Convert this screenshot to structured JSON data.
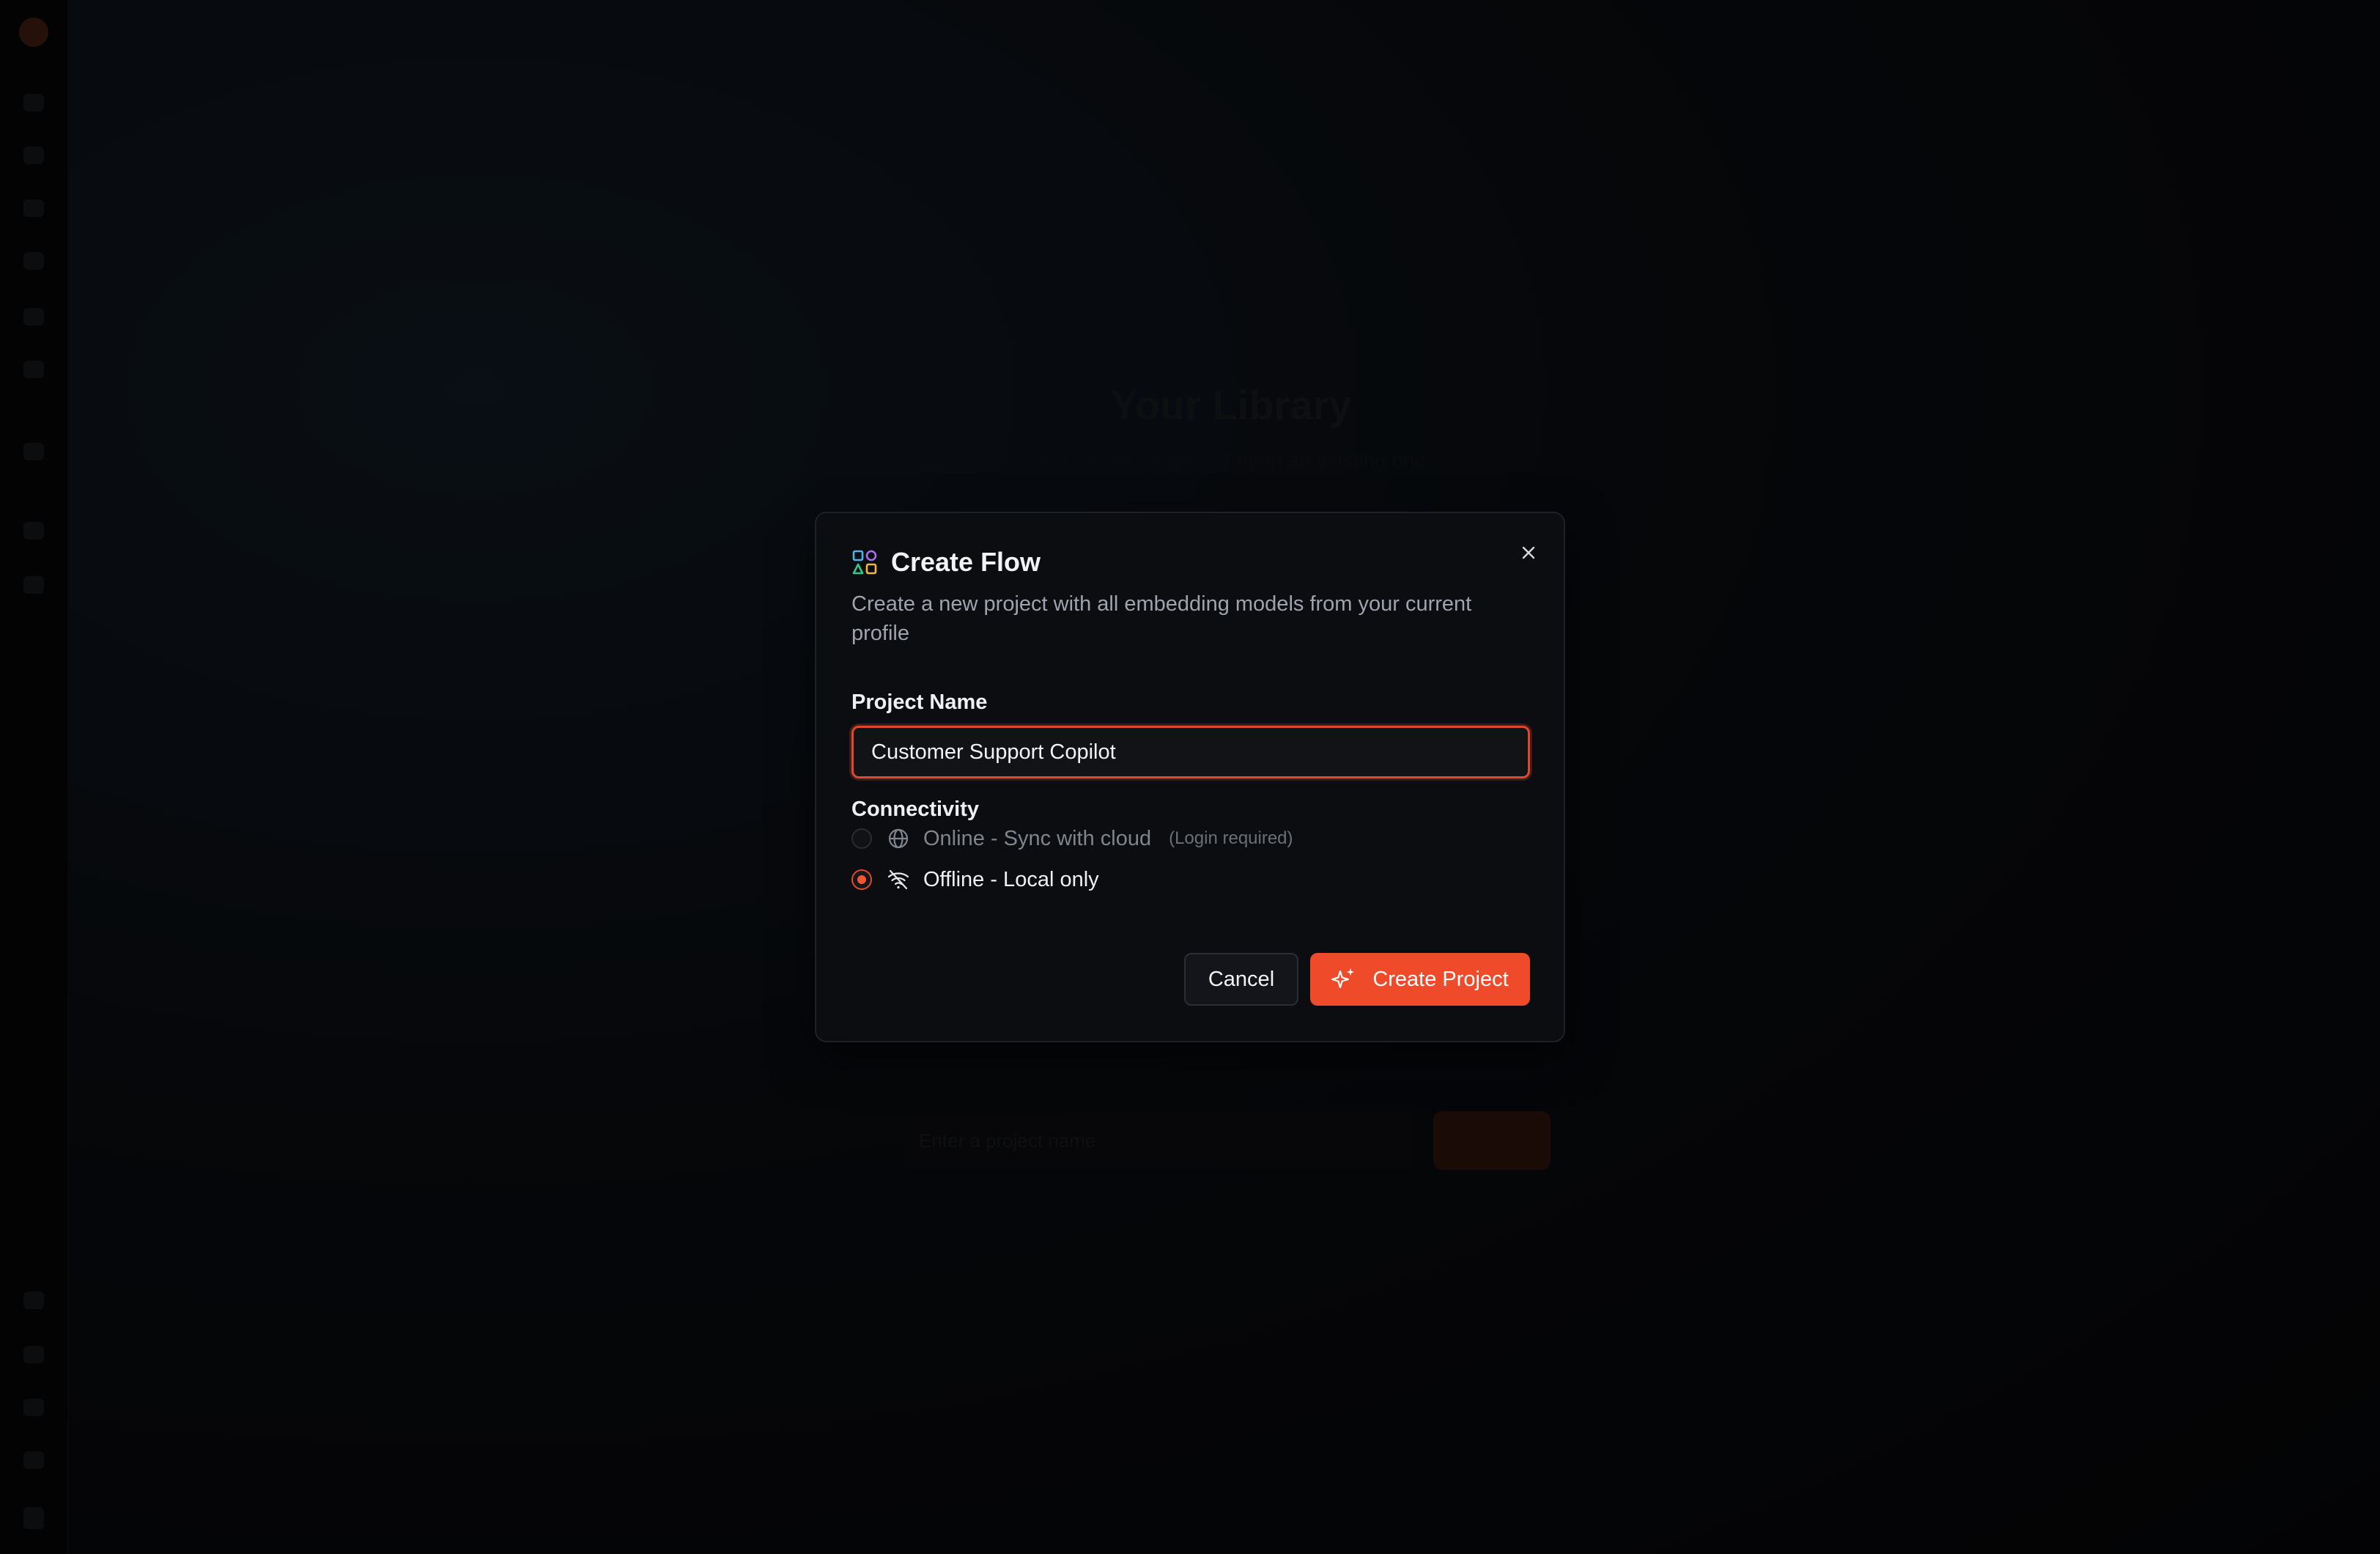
{
  "background": {
    "title": "Your Library",
    "subtitle": "Start a new project or open an existing one",
    "input_placeholder": "Enter a project name"
  },
  "dialog": {
    "title": "Create Flow",
    "description": "Create a new project with all embedding models from your current profile",
    "project_name_label": "Project Name",
    "project_name_value": "Customer Support Copilot",
    "connectivity_label": "Connectivity",
    "options": [
      {
        "label": "Online - Sync with cloud",
        "note": "(Login required)",
        "icon": "globe-icon",
        "selected": false,
        "disabled": true
      },
      {
        "label": "Offline - Local only",
        "note": "",
        "icon": "wifi-off-icon",
        "selected": true,
        "disabled": false
      }
    ],
    "cancel_label": "Cancel",
    "create_label": "Create Project",
    "close_icon": "close-icon",
    "title_icon": "flow-icon",
    "create_icon": "sparkles-icon"
  },
  "colors": {
    "accent": "#ef4a2a",
    "dialog_bg": "#0c0d11",
    "page_bg": "#07080b"
  }
}
